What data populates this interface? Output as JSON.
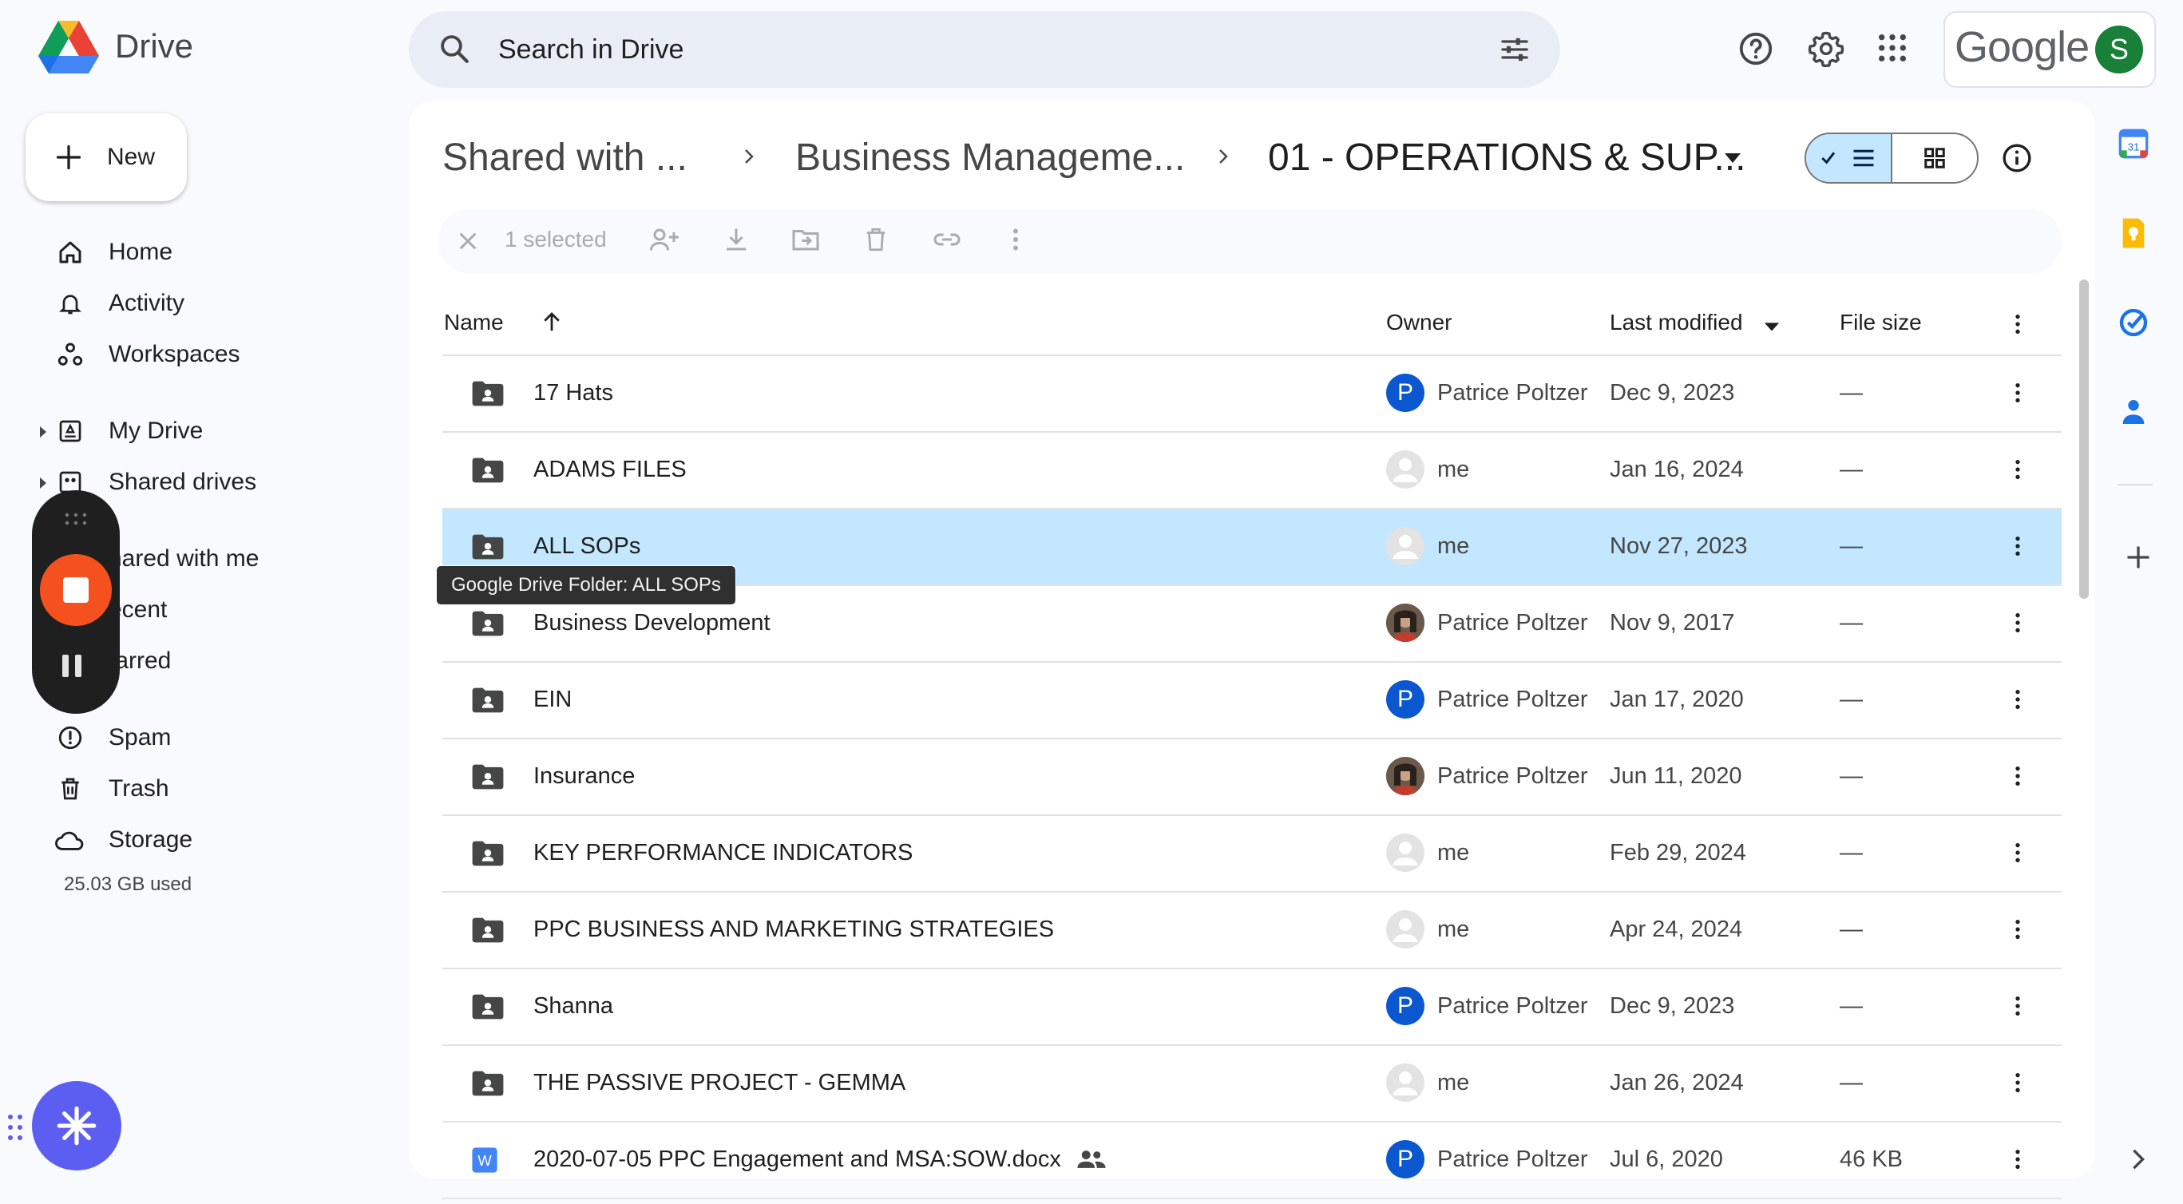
{
  "app": {
    "name": "Drive",
    "google_wordmark": "Google",
    "account_initial": "S"
  },
  "colors": {
    "accent_blue": "#0b57d0",
    "selected_row": "#c2e7ff",
    "recorder_stop": "#f4511e",
    "ai_bubble": "#5b5ef0",
    "avatar_green": "#188038"
  },
  "search": {
    "placeholder": "Search in Drive"
  },
  "sidebar": {
    "new_label": "New",
    "items": [
      {
        "label": "Home",
        "icon": "home-icon"
      },
      {
        "label": "Activity",
        "icon": "bell-icon"
      },
      {
        "label": "Workspaces",
        "icon": "workspaces-icon"
      },
      {
        "label": "My Drive",
        "icon": "my-drive-icon"
      },
      {
        "label": "Shared drives",
        "icon": "shared-drives-icon"
      },
      {
        "label": "hared with me",
        "icon": "shared-with-me-icon"
      },
      {
        "label": "ecent",
        "icon": "recent-icon"
      },
      {
        "label": "tarred",
        "icon": "starred-icon"
      },
      {
        "label": "Spam",
        "icon": "spam-icon"
      },
      {
        "label": "Trash",
        "icon": "trash-icon"
      },
      {
        "label": "Storage",
        "icon": "cloud-icon"
      }
    ],
    "storage_used": "25.03 GB used"
  },
  "breadcrumb": {
    "items": [
      "Shared with ...",
      "Business Manageme...",
      "01 - OPERATIONS & SUP..."
    ]
  },
  "selection": {
    "count_label": "1 selected"
  },
  "table": {
    "headers": {
      "name": "Name",
      "owner": "Owner",
      "modified": "Last modified",
      "size": "File size"
    },
    "rows": [
      {
        "name": "17 Hats",
        "owner": "Patrice Poltzer",
        "owner_type": "p",
        "modified": "Dec 9, 2023",
        "size": "—",
        "type": "folder"
      },
      {
        "name": "ADAMS FILES",
        "owner": "me",
        "owner_type": "me",
        "modified": "Jan 16, 2024",
        "size": "—",
        "type": "folder"
      },
      {
        "name": "ALL SOPs",
        "owner": "me",
        "owner_type": "me",
        "modified": "Nov 27, 2023",
        "size": "—",
        "type": "folder",
        "selected": true
      },
      {
        "name": "Business Development",
        "owner": "Patrice Poltzer",
        "owner_type": "photo",
        "modified": "Nov 9, 2017",
        "size": "—",
        "type": "folder"
      },
      {
        "name": "EIN",
        "owner": "Patrice Poltzer",
        "owner_type": "p",
        "modified": "Jan 17, 2020",
        "size": "—",
        "type": "folder"
      },
      {
        "name": "Insurance",
        "owner": "Patrice Poltzer",
        "owner_type": "photo",
        "modified": "Jun 11, 2020",
        "size": "—",
        "type": "folder"
      },
      {
        "name": "KEY PERFORMANCE INDICATORS",
        "owner": "me",
        "owner_type": "me",
        "modified": "Feb 29, 2024",
        "size": "—",
        "type": "folder"
      },
      {
        "name": "PPC BUSINESS AND MARKETING STRATEGIES",
        "owner": "me",
        "owner_type": "me",
        "modified": "Apr 24, 2024",
        "size": "—",
        "type": "folder"
      },
      {
        "name": "Shanna",
        "owner": "Patrice Poltzer",
        "owner_type": "p",
        "modified": "Dec 9, 2023",
        "size": "—",
        "type": "folder"
      },
      {
        "name": "THE PASSIVE PROJECT - GEMMA",
        "owner": "me",
        "owner_type": "me",
        "modified": "Jan 26, 2024",
        "size": "—",
        "type": "folder"
      },
      {
        "name": "2020-07-05 PPC Engagement and MSA:SOW.docx",
        "owner": "Patrice Poltzer",
        "owner_type": "p",
        "modified": "Jul 6, 2020",
        "size": "46 KB",
        "type": "docx",
        "shared": true
      }
    ]
  },
  "tooltip": "Google Drive Folder: ALL SOPs",
  "owner_p_initial": "P"
}
